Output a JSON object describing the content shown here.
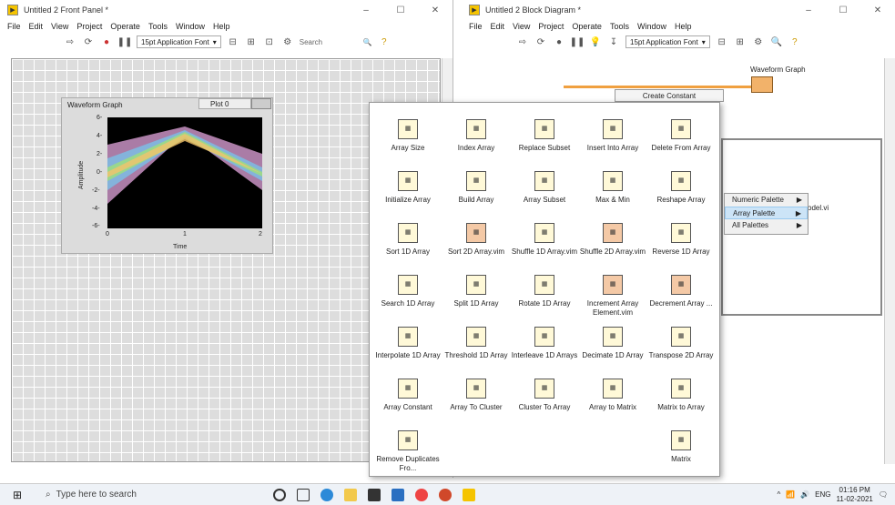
{
  "front_panel": {
    "title": "Untitled 2 Front Panel *",
    "menu": [
      "File",
      "Edit",
      "View",
      "Project",
      "Operate",
      "Tools",
      "Window",
      "Help"
    ],
    "font": "15pt Application Font",
    "search_placeholder": "Search",
    "graph": {
      "title": "Waveform Graph",
      "plot_label": "Plot 0",
      "ylabel": "Amplitude",
      "xlabel": "Time",
      "yticks": [
        "6-",
        "4-",
        "2-",
        "0-",
        "-2-",
        "-4-",
        "-6-"
      ],
      "xticks": [
        "0",
        "1",
        "2"
      ]
    }
  },
  "block_diagram": {
    "title": "Untitled 2 Block Diagram *",
    "menu": [
      "File",
      "Edit",
      "View",
      "Project",
      "Operate",
      "Tools",
      "Window",
      "Help"
    ],
    "font": "15pt Application Font",
    "waveform_label": "Waveform Graph",
    "create_constant": "Create Constant",
    "vi_label": "odel.vi"
  },
  "palette": {
    "items": [
      [
        "Array Size",
        "Index Array",
        "Replace Subset",
        "Insert Into Array",
        "Delete From Array"
      ],
      [
        "Initialize Array",
        "Build Array",
        "Array Subset",
        "Max & Min",
        "Reshape Array"
      ],
      [
        "Sort 1D Array",
        "Sort 2D Array.vim",
        "Shuffle 1D Array.vim",
        "Shuffle 2D Array.vim",
        "Reverse 1D Array"
      ],
      [
        "Search 1D Array",
        "Split 1D Array",
        "Rotate 1D Array",
        "Increment Array Element.vim",
        "Decrement Array ..."
      ],
      [
        "Interpolate 1D Array",
        "Threshold 1D Array",
        "Interleave 1D Arrays",
        "Decimate 1D Array",
        "Transpose 2D Array"
      ],
      [
        "Array Constant",
        "Array To Cluster",
        "Cluster To Array",
        "Array to Matrix",
        "Matrix to Array"
      ],
      [
        "Remove Duplicates Fro...",
        "",
        "",
        "",
        "Matrix"
      ]
    ]
  },
  "context_menu": {
    "items": [
      "Numeric Palette",
      "Array Palette",
      "All Palettes"
    ]
  },
  "taskbar": {
    "search": "Type here to search",
    "time": "01:16 PM",
    "date": "11-02-2021",
    "lang": "ENG"
  }
}
